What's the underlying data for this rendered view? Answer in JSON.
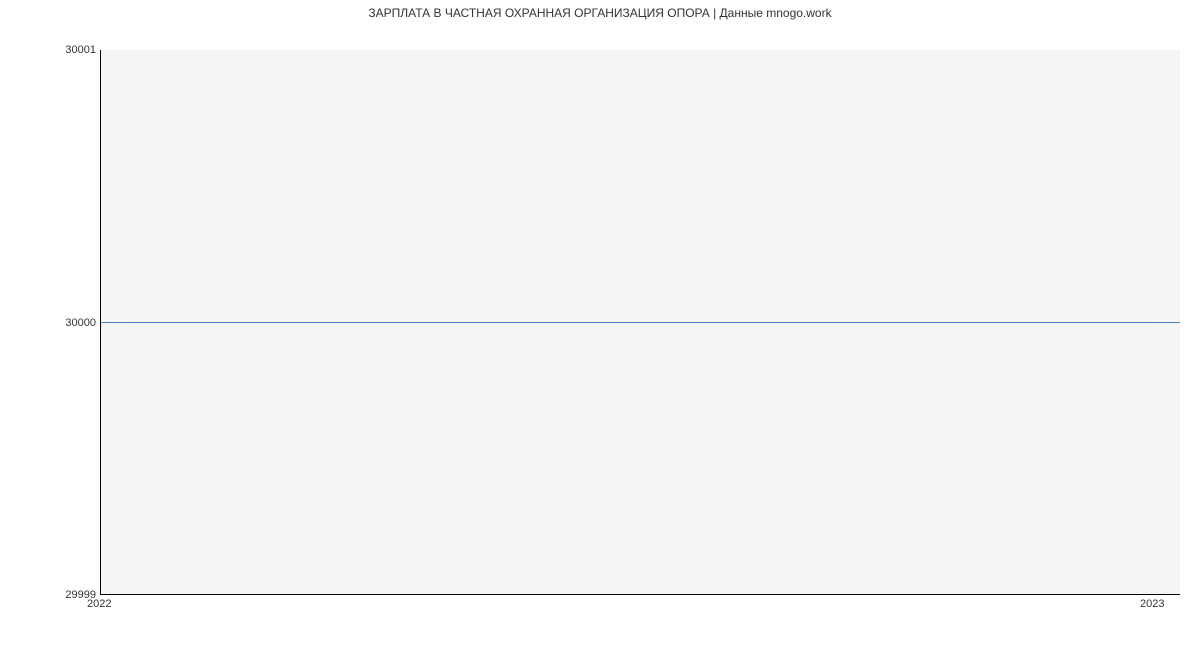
{
  "chart_data": {
    "type": "line",
    "title": "ЗАРПЛАТА В  ЧАСТНАЯ ОХРАННАЯ ОРГАНИЗАЦИЯ ОПОРА | Данные mnogo.work",
    "x": [
      2022,
      2023
    ],
    "values": [
      30000,
      30000
    ],
    "ylim": [
      29999,
      30001
    ],
    "xlim": [
      2022,
      2023
    ],
    "y_ticks": [
      29999,
      30000,
      30001
    ],
    "x_ticks": [
      2022,
      2023
    ],
    "xlabel": "",
    "ylabel": "",
    "line_color": "#4a7fc8"
  }
}
